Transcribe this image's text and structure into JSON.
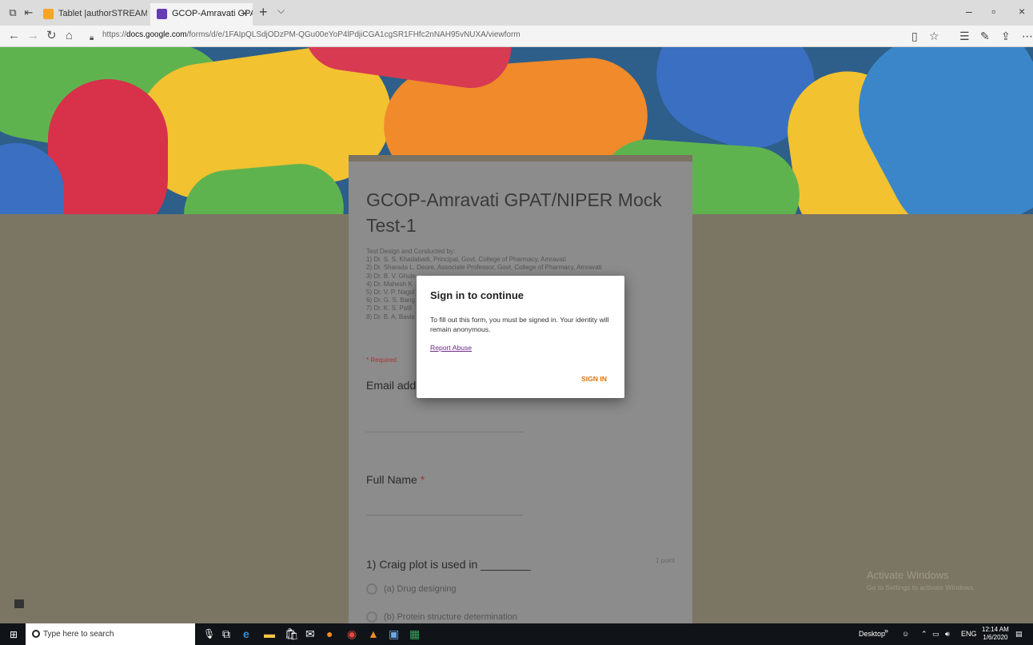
{
  "browser": {
    "tabs": [
      {
        "title": "Tablet |authorSTREAM",
        "active": false,
        "favicon_color": "#f5a623"
      },
      {
        "title": "GCOP-Amravati GPAT/N",
        "active": true,
        "favicon_color": "#673ab7"
      }
    ],
    "tab_close": "×",
    "new_tab": "+",
    "tab_list": "⌵",
    "url_prefix": "https://",
    "url_host": "docs.google.com",
    "url_path": "/forms/d/e/1FAIpQLSdjODzPM-QGu00eYoP4lPdjiCGA1cgSR1FHfc2nNAH95vNUXA/viewform",
    "window_controls": [
      "–",
      "▫",
      "×"
    ]
  },
  "form": {
    "title": "GCOP-Amravati GPAT/NIPER Mock Test-1",
    "description": "Test Design and Conducted by:\n1) Dr. S. S. Khadabadi, Principal, Govt. College of Pharmacy, Amravati\n2) Dr. Sharada L. Deore, Associate Professor, Govt. College of Pharmacy, Amravati\n3) Dr. B. V. Ghule\n4) Dr. Mahesh K\n5) Dr. V. P. Nagul\n6) Dr. G. S. Bang\n7) Dr. K. S. Patil\n8) Dr. B. A. Bavis",
    "required_note": "* Required",
    "q_email": "Email addr",
    "q_fullname": "Full Name",
    "required_star": "*",
    "q1": "1) Craig plot is used in ________",
    "q1_points": "1 point",
    "q1_options": [
      "(a) Drug designing",
      "(b) Protein structure determination"
    ]
  },
  "dialog": {
    "title": "Sign in to continue",
    "message": "To fill out this form, you must be signed in. Your identity will remain anonymous.",
    "report": "Report Abuse",
    "button": "SIGN IN"
  },
  "watermark": {
    "line1": "Activate Windows",
    "line2": "Go to Settings to activate Windows."
  },
  "taskbar": {
    "search_placeholder": "Type here to search",
    "desktop": "Desktop",
    "tray_arrows": "»",
    "language": "ENG",
    "time": "12:14 AM",
    "date": "1/6/2020"
  }
}
